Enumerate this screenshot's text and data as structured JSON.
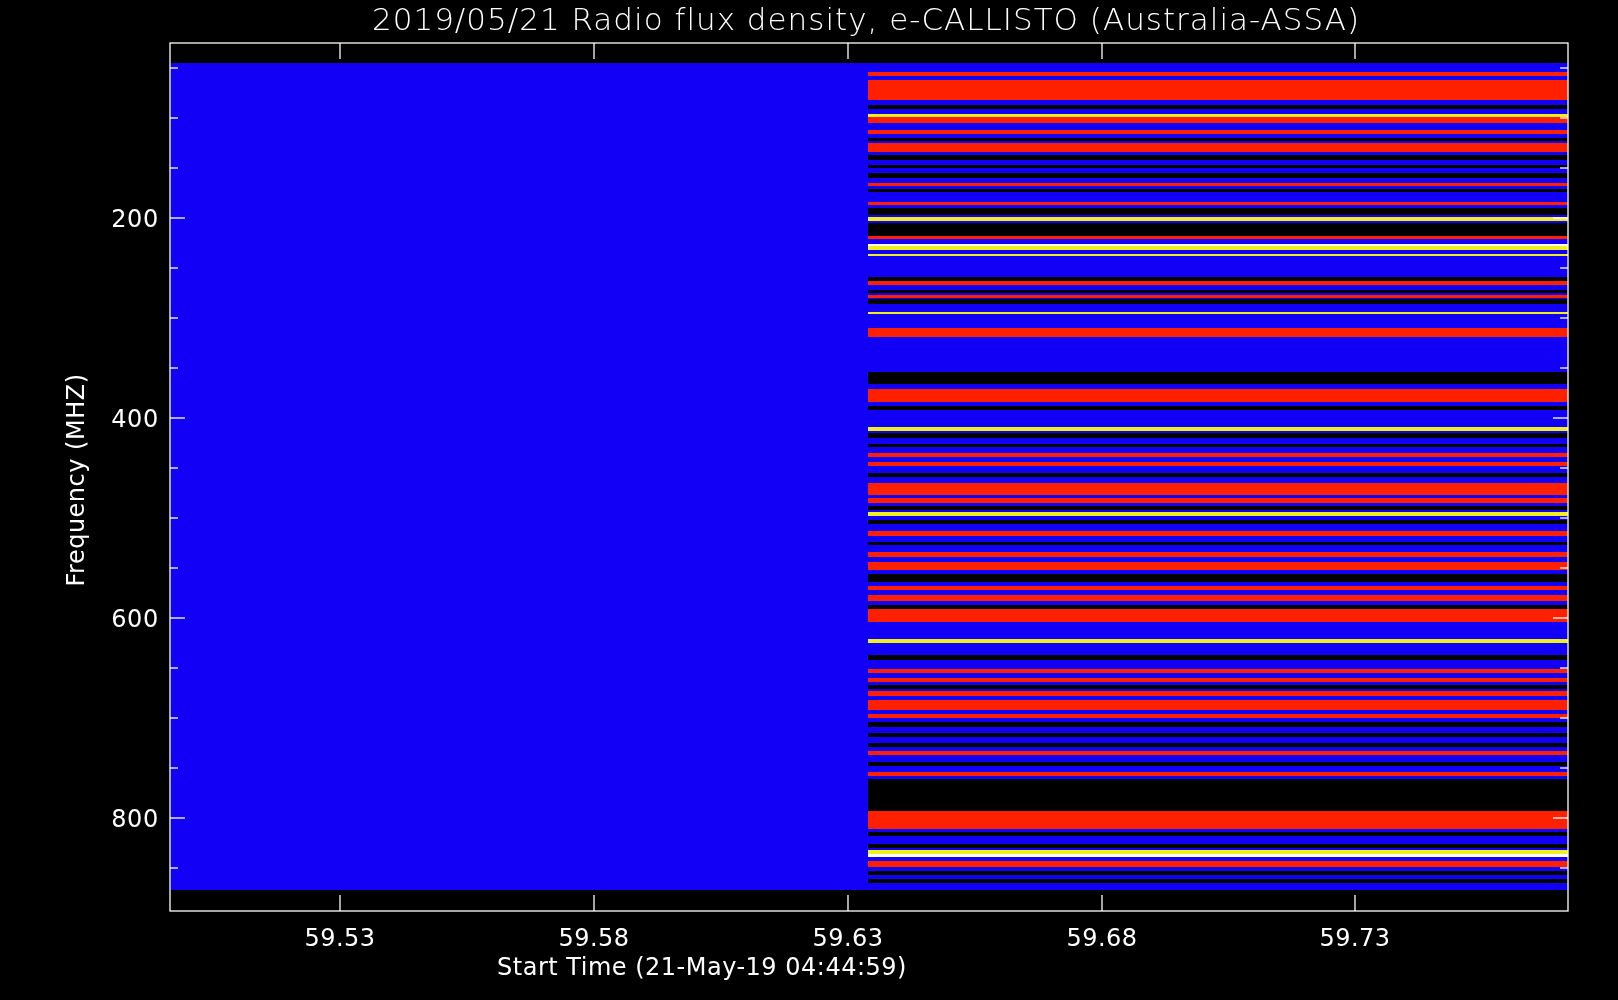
{
  "plot": {
    "title": "2019/05/21  Radio flux density, e-CALLISTO (Australia-ASSA)",
    "y_axis": {
      "label": "Frequency (MHZ)",
      "tick_labels": [
        "200",
        "400",
        "600",
        "800"
      ]
    },
    "x_axis": {
      "label": "Start Time (21-May-19 04:44:59)",
      "tick_labels": [
        "59.53",
        "59.58",
        "59.63",
        "59.68",
        "59.73"
      ]
    }
  }
}
